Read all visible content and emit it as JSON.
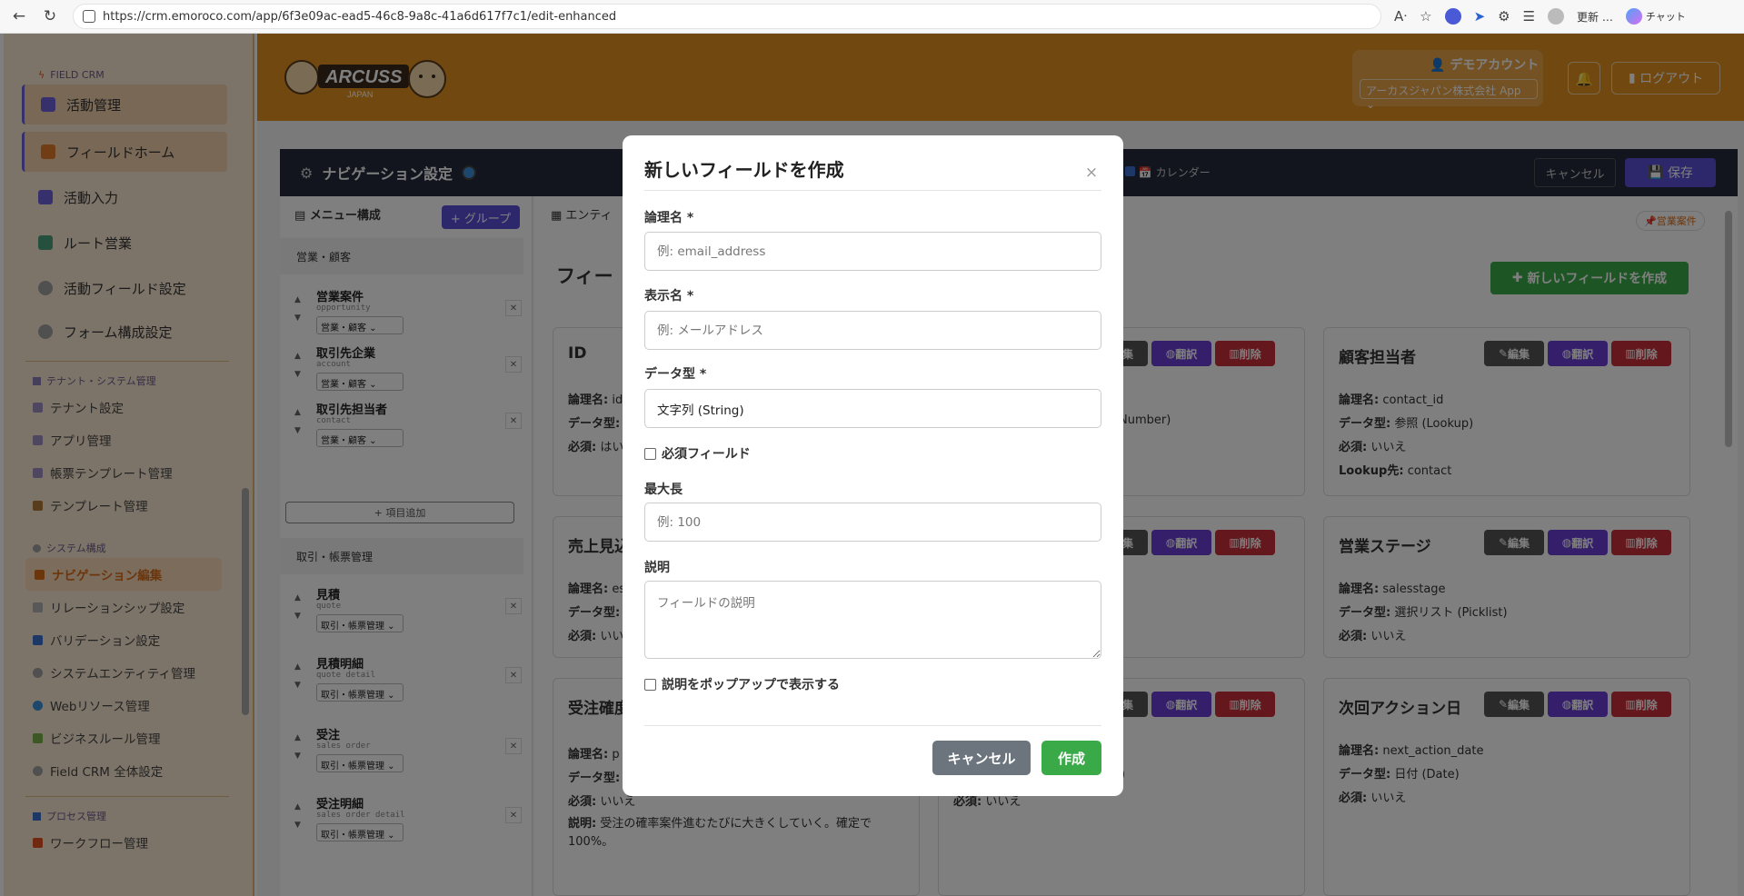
{
  "browser": {
    "url": "https://crm.emoroco.com/app/6f3e09ac-ead5-46c8-9a8c-41a6d617f7c1/edit-enhanced",
    "update_label": "更新 …",
    "chat_label": "チャット"
  },
  "sidebar": {
    "section_field": "FIELD CRM",
    "main_items": [
      {
        "label": "活動管理",
        "active": true
      },
      {
        "label": "フィールドホーム",
        "active": true
      },
      {
        "label": "活動入力",
        "active": false
      },
      {
        "label": "ルート営業",
        "active": false
      },
      {
        "label": "活動フィールド設定",
        "active": false
      },
      {
        "label": "フォーム構成設定",
        "active": false
      }
    ],
    "section_tenant": "テナント・システム管理",
    "tenant_items": [
      "テナント設定",
      "アプリ管理",
      "帳票テンプレート管理",
      "テンプレート管理"
    ],
    "section_system": "システム構成",
    "system_items": [
      "ナビゲーション編集",
      "リレーションシップ設定",
      "バリデーション設定",
      "システムエンティティ管理",
      "Webリソース管理",
      "ビジネスルール管理",
      "Field CRM 全体設定"
    ],
    "section_process": "プロセス管理",
    "process_items": [
      "ワークフロー管理"
    ]
  },
  "header": {
    "logo_text": "ARCUSS",
    "logo_sub": "JAPAN",
    "account_name": "デモアカウント",
    "tenant_select": "アーカスジャパン株式会社 App",
    "logout_label": "ログアウト"
  },
  "settings_bar": {
    "title": "ナビゲーション設定",
    "calendar_label": "カレンダー",
    "cancel_label": "キャンセル",
    "save_label": "保存"
  },
  "menu": {
    "heading": "メニュー構成",
    "add_group_label": "+ グループ",
    "add_item_label": "+ 項目追加",
    "groups": [
      {
        "name": "営業・顧客",
        "items": [
          {
            "label": "営業案件",
            "code": "opportunity",
            "group": "営業・顧客"
          },
          {
            "label": "取引先企業",
            "code": "account",
            "group": "営業・顧客"
          },
          {
            "label": "取引先担当者",
            "code": "contact",
            "group": "営業・顧客"
          }
        ]
      },
      {
        "name": "取引・帳票管理",
        "items": [
          {
            "label": "見積",
            "code": "quote",
            "group": "取引・帳票管理"
          },
          {
            "label": "見積明細",
            "code": "quote detail",
            "group": "取引・帳票管理"
          },
          {
            "label": "受注",
            "code": "sales order",
            "group": "取引・帳票管理"
          },
          {
            "label": "受注明細",
            "code": "sales order detail",
            "group": "取引・帳票管理"
          }
        ]
      }
    ]
  },
  "content": {
    "tab_label": "エンティ",
    "badge": "営業案件",
    "section_title": "フィー",
    "new_field_label": "新しいフィールドを作成",
    "btn_edit": "編集",
    "btn_translate": "翻訳",
    "btn_delete": "削除",
    "prop_logical": "論理名:",
    "prop_type": "データ型:",
    "prop_required": "必須:",
    "prop_lookup": "Lookup先:",
    "prop_desc": "説明:",
    "cards": {
      "id": {
        "title": "ID",
        "logical": "id",
        "required": "はい"
      },
      "sales_forecast": {
        "title": "売上見込",
        "logical": "es",
        "required": "いい"
      },
      "order_prob": {
        "title": "受注確度",
        "logical": "p",
        "required": "いいえ",
        "desc": "受注の確率案件進むたびに大きくしていく。確定で100%。"
      },
      "mid_1": {
        "type_tail": "Number)"
      },
      "mid_3": {
        "required": "いいえ",
        "type_tail": ")"
      },
      "contact_owner": {
        "title": "顧客担当者",
        "logical": "contact_id",
        "type": "参照 (Lookup)",
        "required": "いいえ",
        "lookup": "contact"
      },
      "sales_stage": {
        "title": "営業ステージ",
        "logical": "salesstage",
        "type": "選択リスト (Picklist)",
        "required": "いいえ"
      },
      "next_action": {
        "title": "次回アクション日",
        "logical": "next_action_date",
        "type": "日付 (Date)",
        "required": "いいえ"
      }
    }
  },
  "modal": {
    "title": "新しいフィールドを作成",
    "logical_name_label": "論理名 *",
    "logical_name_placeholder": "例: email_address",
    "display_name_label": "表示名 *",
    "display_name_placeholder": "例: メールアドレス",
    "data_type_label": "データ型 *",
    "data_type_value": "文字列 (String)",
    "required_label": "必須フィールド",
    "max_length_label": "最大長",
    "max_length_placeholder": "例: 100",
    "description_label": "説明",
    "description_placeholder": "フィールドの説明",
    "popup_label": "説明をポップアップで表示する",
    "cancel_label": "キャンセル",
    "create_label": "作成"
  }
}
